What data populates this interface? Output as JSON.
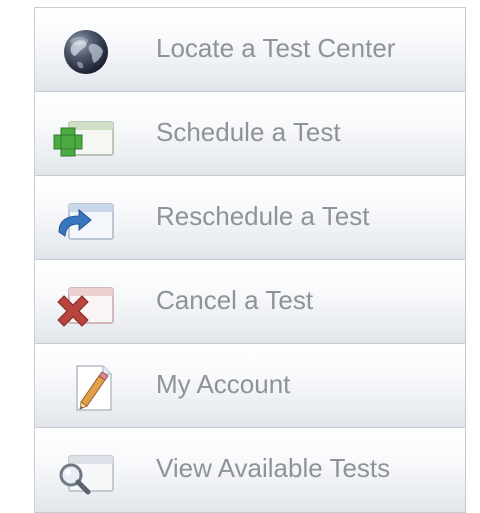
{
  "menu": {
    "items": [
      {
        "label": "Locate a Test Center",
        "icon": "globe-icon"
      },
      {
        "label": "Schedule a Test",
        "icon": "add-window-icon"
      },
      {
        "label": "Reschedule a Test",
        "icon": "reschedule-window-icon"
      },
      {
        "label": "Cancel a Test",
        "icon": "cancel-window-icon"
      },
      {
        "label": "My Account",
        "icon": "pencil-document-icon"
      },
      {
        "label": "View Available Tests",
        "icon": "search-window-icon"
      }
    ]
  },
  "colors": {
    "label_text": "#8f9399",
    "border": "#c4cad3",
    "green_plus": "#3f9a3a",
    "blue_arrow": "#2f67ad",
    "red_x": "#b3433f"
  }
}
